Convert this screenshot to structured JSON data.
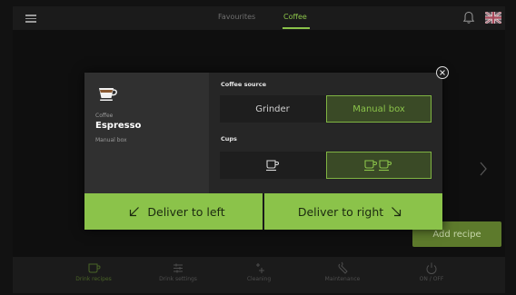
{
  "header": {
    "tabs": [
      {
        "label": "Favourites",
        "active": false
      },
      {
        "label": "Coffee",
        "active": true
      }
    ],
    "icons": [
      "hamburger-menu-icon",
      "bell-icon",
      "uk-flag-icon"
    ]
  },
  "main": {
    "add_recipe_label": "Add recipe"
  },
  "dialog": {
    "drink": {
      "category": "Coffee",
      "name": "Espresso",
      "source": "Manual box",
      "icon": "espresso-cup-icon"
    },
    "coffee_source": {
      "title": "Coffee source",
      "options": [
        {
          "label": "Grinder",
          "selected": false
        },
        {
          "label": "Manual box",
          "selected": true
        }
      ]
    },
    "cups": {
      "title": "Cups",
      "options": [
        {
          "icon": "single-cup-icon",
          "selected": false
        },
        {
          "icon": "double-cup-icon",
          "selected": true
        }
      ]
    },
    "deliver_left_label": "Deliver to left",
    "deliver_right_label": "Deliver to right"
  },
  "bottom_nav": [
    {
      "label": "Drink recipes",
      "icon": "cup-icon",
      "active": true
    },
    {
      "label": "Drink settings",
      "icon": "sliders-icon",
      "active": false
    },
    {
      "label": "Cleaning",
      "icon": "sparkle-icon",
      "active": false
    },
    {
      "label": "Maintenance",
      "icon": "wrench-icon",
      "active": false
    },
    {
      "label": "ON / OFF",
      "icon": "power-icon",
      "active": false
    }
  ],
  "colors": {
    "accent": "#8bc34a",
    "background": "#121212",
    "panel": "#262626"
  }
}
